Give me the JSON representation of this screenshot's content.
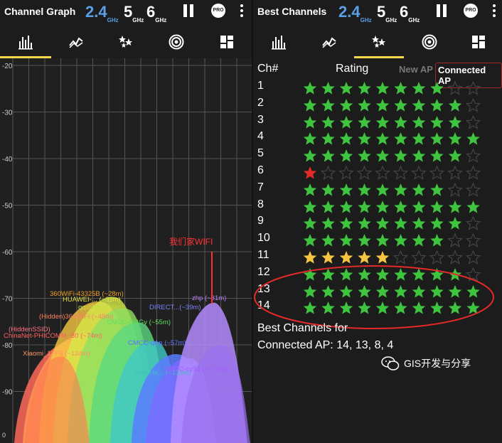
{
  "left": {
    "title": "Channel Graph",
    "bands": [
      {
        "big": "2.4",
        "sub": "GHz",
        "active": true
      },
      {
        "big": "5",
        "sub": "GHz",
        "active": false
      },
      {
        "big": "6",
        "sub": "GHz",
        "active": false
      }
    ],
    "pro_label": "PRO",
    "tabs": [
      "channel-graph",
      "time-graph",
      "channel-rating",
      "ap-list",
      "dashboard"
    ],
    "active_tab": 0
  },
  "right": {
    "title": "Best Channels",
    "bands": [
      {
        "big": "2.4",
        "sub": "GHz",
        "active": true
      },
      {
        "big": "5",
        "sub": "GHz",
        "active": false
      },
      {
        "big": "6",
        "sub": "GHz",
        "active": false
      }
    ],
    "pro_label": "PRO",
    "tabs": [
      "channel-graph",
      "time-graph",
      "channel-rating",
      "ap-list",
      "dashboard"
    ],
    "active_tab": 2,
    "header": {
      "ch": "Ch#",
      "rating": "Rating",
      "new_ap": "New AP",
      "connected_ap": "Connected AP"
    },
    "rows": [
      {
        "ch": "1",
        "filled": 8,
        "color": "green"
      },
      {
        "ch": "2",
        "filled": 9,
        "color": "green"
      },
      {
        "ch": "3",
        "filled": 9,
        "color": "green"
      },
      {
        "ch": "4",
        "filled": 10,
        "color": "green"
      },
      {
        "ch": "5",
        "filled": 9,
        "color": "green"
      },
      {
        "ch": "6",
        "filled": 1,
        "color": "red"
      },
      {
        "ch": "7",
        "filled": 8,
        "color": "green"
      },
      {
        "ch": "8",
        "filled": 10,
        "color": "green"
      },
      {
        "ch": "9",
        "filled": 9,
        "color": "green"
      },
      {
        "ch": "10",
        "filled": 8,
        "color": "green"
      },
      {
        "ch": "11",
        "filled": 5,
        "color": "yellow"
      },
      {
        "ch": "12",
        "filled": 9,
        "color": "green"
      },
      {
        "ch": "13",
        "filled": 10,
        "color": "green"
      },
      {
        "ch": "14",
        "filled": 10,
        "color": "green"
      }
    ],
    "best_line1": "Best Channels for",
    "best_line2": "Connected AP: 14, 13, 8, 4",
    "watermark": "GIS开发与分享"
  },
  "graph": {
    "y_ticks": [
      "-20",
      "-30",
      "-40",
      "-50",
      "-60",
      "-70",
      "-80",
      "-90"
    ],
    "annotation": "我们家WIFI",
    "networks": [
      {
        "name": "360WiFi-43325B (~28m)",
        "color": "#f0a020"
      },
      {
        "name": "HUAWEI-... (~31m)",
        "color": "#e0e040"
      },
      {
        "name": "qqs588 (~39m)",
        "color": "#c0e040"
      },
      {
        "name": "(Hidden)360WiFi (~48m)",
        "color": "#ff8060"
      },
      {
        "name": "CMCC-BHGy (~55m)",
        "color": "#60e060"
      },
      {
        "name": "ChinaNet-PHICOMM_B0 (~74m)",
        "color": "#ff6060"
      },
      {
        "name": "(HiddenSSID)",
        "color": "#ff7080"
      },
      {
        "name": "zhp (~31m)",
        "color": "#c080ff"
      },
      {
        "name": "DIRECT...(~39m)",
        "color": "#8080ff"
      },
      {
        "name": "CMCC-qAp (~57m)",
        "color": "#6070ff"
      },
      {
        "name": "Xiaomi_1FF5 (~124m)",
        "color": "#ff9060"
      },
      {
        "name": "ShanHe... (~133m)",
        "color": "#40c0c0"
      },
      {
        "name": "CMCC-cy34 (~172m)",
        "color": "#a060ff"
      }
    ],
    "accent": "#ff3030"
  }
}
